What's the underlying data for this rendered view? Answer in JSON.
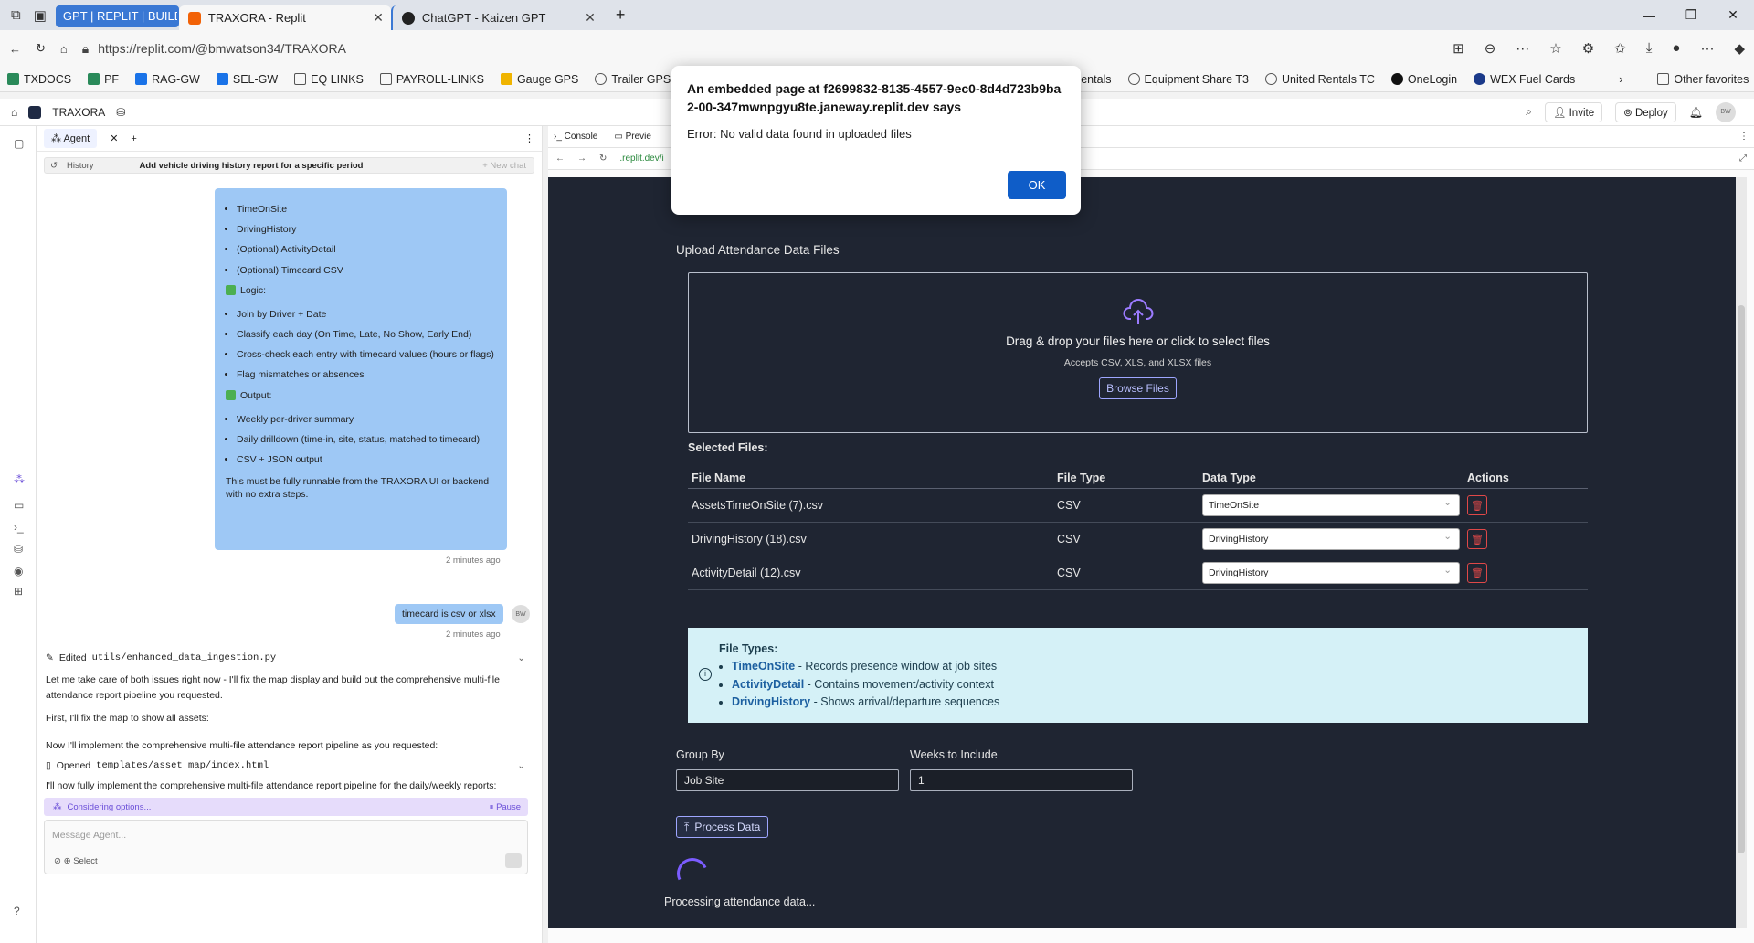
{
  "browser": {
    "tab_group_label": "GPT | REPLIT | BUILDIN",
    "tabs": [
      {
        "label": "TRAXORA - Replit",
        "active": true
      },
      {
        "label": "ChatGPT - Kaizen GPT",
        "active": false
      }
    ],
    "url": "https://replit.com/@bmwatson34/TRAXORA",
    "favorites": [
      "TXDOCS",
      "PF",
      "RAG-GW",
      "SEL-GW",
      "EQ LINKS",
      "PAYROLL-LINKS",
      "Gauge GPS",
      "Trailer GPS",
      "entals",
      "Equipment Share T3",
      "United Rentals TC",
      "OneLogin",
      "WEX Fuel Cards"
    ],
    "other_favorites": "Other favorites"
  },
  "app": {
    "project_name": "TRAXORA",
    "invite_label": "Invite",
    "deploy_label": "Deploy",
    "avatar_initials": "BW"
  },
  "agent": {
    "tab_label": "Agent",
    "history_label": "History",
    "history_title": "Add vehicle driving history report for a specific period",
    "new_chat_label": "New chat",
    "bubble": {
      "inputs": [
        "TimeOnSite",
        "DrivingHistory",
        "(Optional) ActivityDetail",
        "(Optional) Timecard CSV"
      ],
      "logic_label": "Logic:",
      "logic": [
        "Join by Driver + Date",
        "Classify each day (On Time, Late, No Show, Early End)",
        "Cross-check each entry with timecard values (hours or flags)",
        "Flag mismatches or absences"
      ],
      "output_label": "Output:",
      "output": [
        "Weekly per-driver summary",
        "Daily drilldown (time-in, site, status, matched to timecard)",
        "CSV + JSON output"
      ],
      "footer": "This must be fully runnable from the TRAXORA UI or backend with no extra steps."
    },
    "ts1": "2 minutes ago",
    "user_msg": "timecard is csv or xlsx",
    "ts2": "2 minutes ago",
    "edited_prefix": "Edited",
    "edited_file": "utils/enhanced_data_ingestion.py",
    "msg1": "Let me take care of both issues right now - I'll fix the map display and build out the comprehensive multi-file attendance report pipeline you requested.",
    "msg2": "First, I'll fix the map to show all assets:",
    "msg3": "Now I'll implement the comprehensive multi-file attendance report pipeline as you requested:",
    "opened_prefix": "Opened",
    "opened_file": "templates/asset_map/index.html",
    "msg4": "I'll now fully implement the comprehensive multi-file attendance report pipeline for the daily/weekly reports:",
    "considering": "Considering options...",
    "pause_label": "Pause",
    "input_placeholder": "Message Agent...",
    "select_label": "Select"
  },
  "right_pane": {
    "console_tab": "Console",
    "preview_tab": "Previe",
    "preview_url": ".replit.dev/i"
  },
  "preview": {
    "upload_title": "Upload Attendance Data Files",
    "dz_main": "Drag & drop your files here or click to select files",
    "dz_sub": "Accepts CSV, XLS, and XLSX files",
    "browse_label": "Browse Files",
    "selected_files_label": "Selected Files:",
    "columns": [
      "File Name",
      "File Type",
      "Data Type",
      "Actions"
    ],
    "files": [
      {
        "name": "AssetsTimeOnSite (7).csv",
        "type": "CSV",
        "data_type": "TimeOnSite"
      },
      {
        "name": "DrivingHistory (18).csv",
        "type": "CSV",
        "data_type": "DrivingHistory"
      },
      {
        "name": "ActivityDetail (12).csv",
        "type": "CSV",
        "data_type": "DrivingHistory"
      }
    ],
    "file_types_title": "File Types:",
    "file_types": [
      {
        "name": "TimeOnSite",
        "desc": " - Records presence window at job sites"
      },
      {
        "name": "ActivityDetail",
        "desc": " - Contains movement/activity context"
      },
      {
        "name": "DrivingHistory",
        "desc": " - Shows arrival/departure sequences"
      }
    ],
    "group_by_label": "Group By",
    "group_by_value": "Job Site",
    "weeks_label": "Weeks to Include",
    "weeks_value": "1",
    "process_label": "Process Data",
    "processing_text": "Processing attendance data..."
  },
  "dialog": {
    "title": "An embedded page at f2699832-8135-4557-9ec0-8d4d723b9ba2-00-347mwnpgyu8te.janeway.replit.dev says",
    "message": "Error: No valid data found in uploaded files",
    "ok_label": "OK"
  }
}
